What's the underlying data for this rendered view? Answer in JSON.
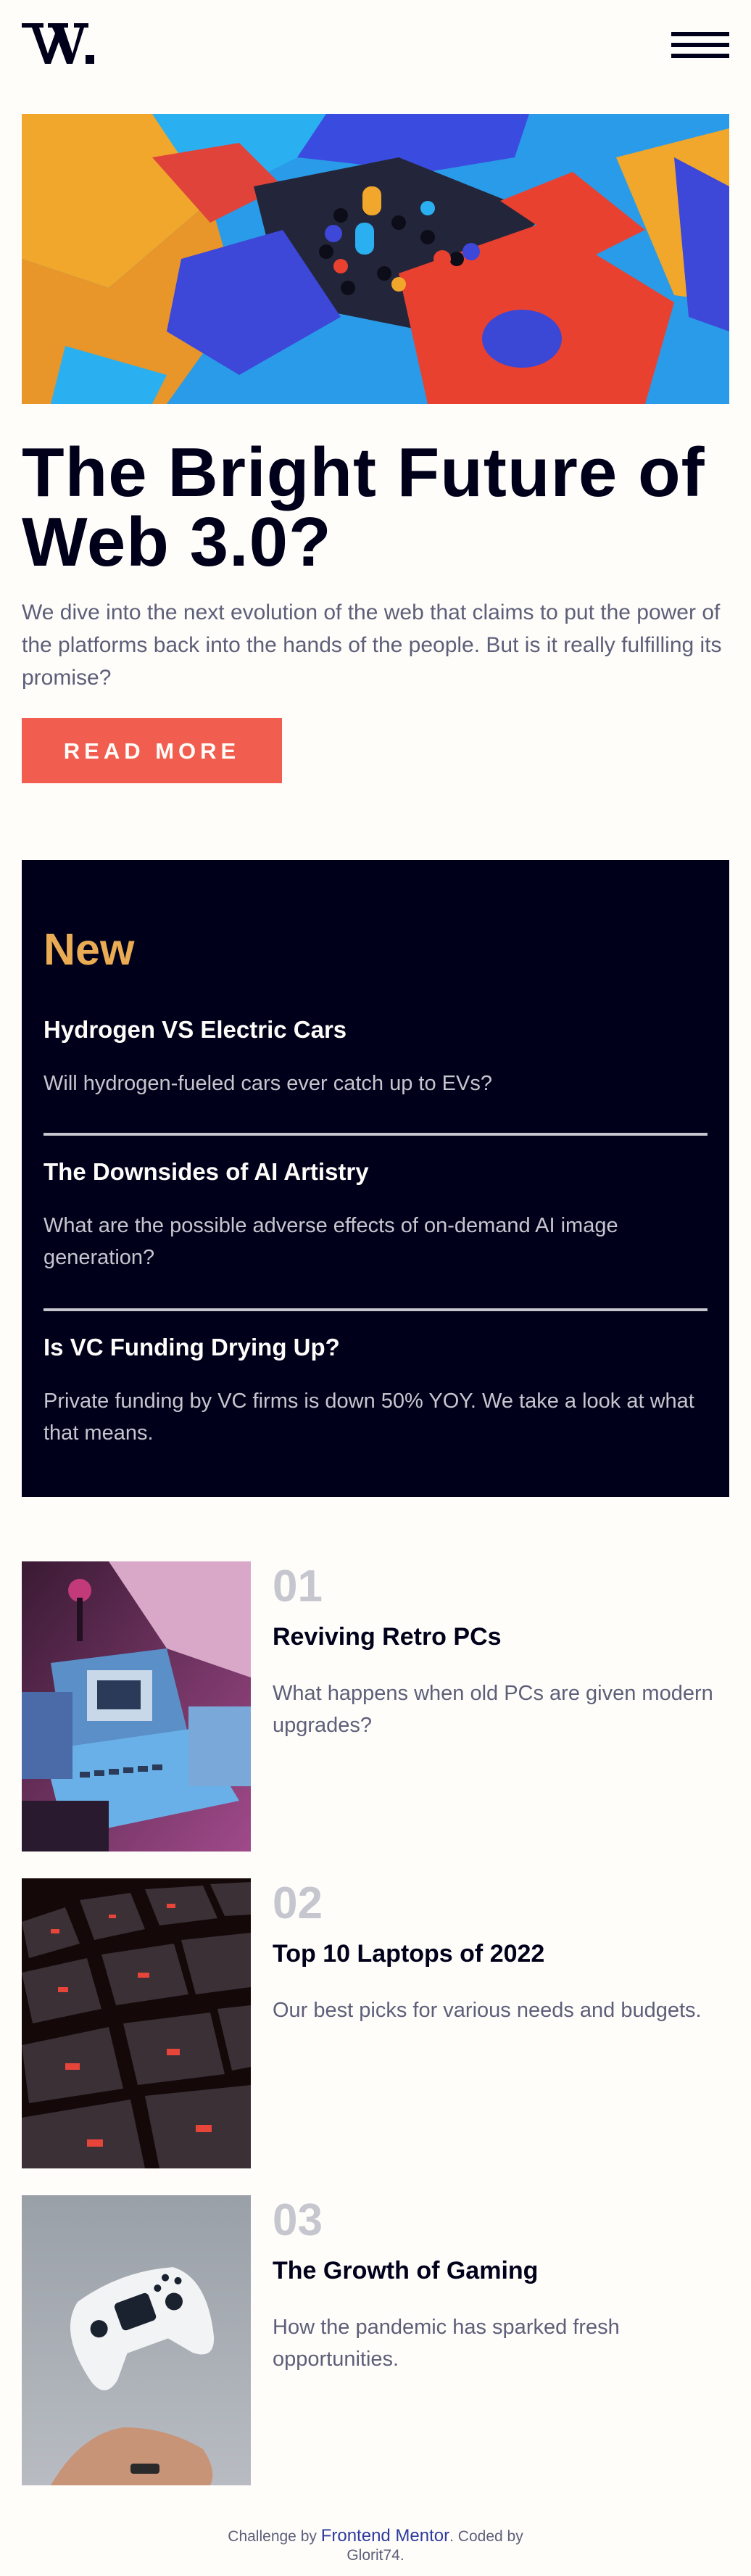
{
  "header": {
    "logo_icon": "w-logo-icon",
    "menu_icon": "hamburger-menu-icon"
  },
  "hero": {
    "title": "The Bright Future of Web 3.0?",
    "description": "We dive into the next evolution of the web that claims to put the power of the platforms back into the hands of the people. But is it really fulfilling its promise?",
    "button_label": "READ MORE",
    "image_icon": "abstract-3d-blocks-image"
  },
  "new_section": {
    "title": "New",
    "items": [
      {
        "title": "Hydrogen VS Electric Cars",
        "description": "Will hydrogen-fueled cars ever catch up to EVs?"
      },
      {
        "title": "The Downsides of AI Artistry",
        "description": "What are the possible adverse effects of on-demand AI image generation?"
      },
      {
        "title": "Is VC Funding Drying Up?",
        "description": "Private funding by VC firms is down 50% YOY. We take a look at what that means."
      }
    ]
  },
  "articles": [
    {
      "number": "01",
      "title": "Reviving Retro PCs",
      "description": "What happens when old PCs are given modern upgrades?",
      "image_icon": "retro-pc-image"
    },
    {
      "number": "02",
      "title": "Top 10 Laptops of 2022",
      "description": "Our best picks for various needs and budgets.",
      "image_icon": "laptop-keyboard-image"
    },
    {
      "number": "03",
      "title": "The Growth of Gaming",
      "description": "How the pandemic has sparked fresh opportunities.",
      "image_icon": "game-controller-image"
    }
  ],
  "footer": {
    "prefix": "Challenge by ",
    "link_text": "Frontend Mentor",
    "middle": ". Coded by ",
    "author": "Glorit74",
    "suffix": "."
  },
  "colors": {
    "background": "#fffdfa",
    "dark": "#00001a",
    "accent_red": "#f15e50",
    "accent_gold": "#e9ab53",
    "muted": "#5d5f79",
    "light_gray": "#c5c6ce",
    "link_blue": "#2e3b9e"
  }
}
